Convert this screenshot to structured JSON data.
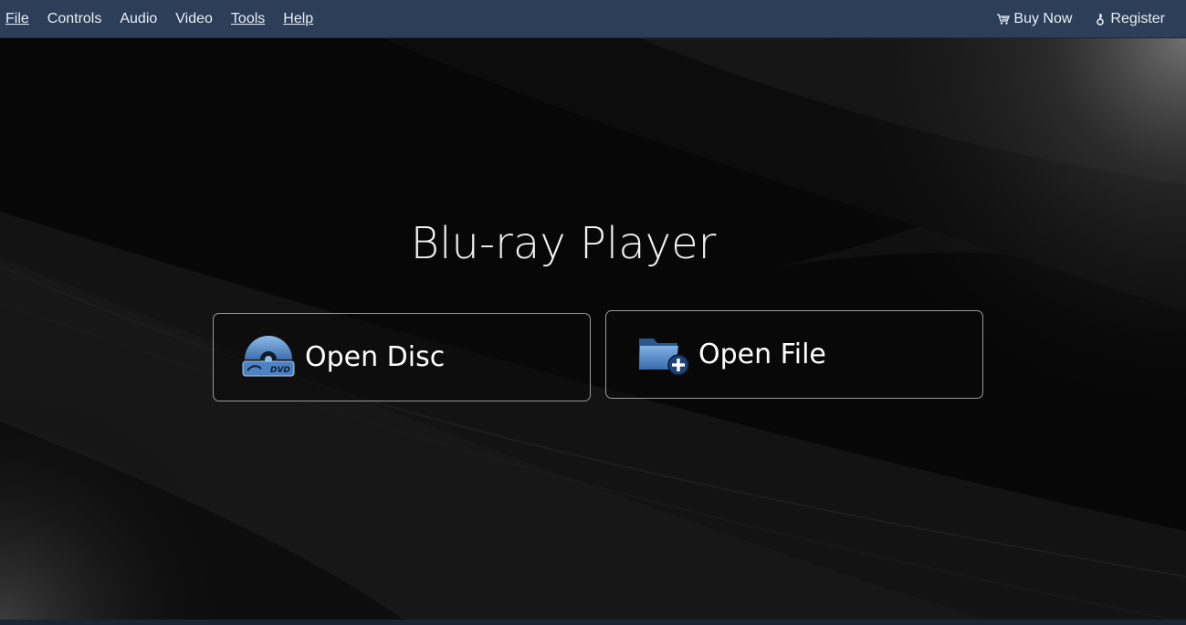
{
  "menubar": {
    "items": [
      {
        "label": "File",
        "mnemonic": true
      },
      {
        "label": "Controls",
        "mnemonic": false
      },
      {
        "label": "Audio",
        "mnemonic": false
      },
      {
        "label": "Video",
        "mnemonic": false
      },
      {
        "label": "Tools",
        "mnemonic": true
      },
      {
        "label": "Help",
        "mnemonic": true
      }
    ],
    "buy_now": {
      "label": "Buy Now",
      "icon": "cart-icon"
    },
    "register": {
      "label": "Register",
      "icon": "key-icon"
    }
  },
  "main": {
    "title": "Blu-ray Player",
    "open_disc": {
      "label": "Open Disc",
      "icon": "disc-icon",
      "icon_text": "DVD"
    },
    "open_file": {
      "label": "Open File",
      "icon": "folder-add-icon"
    }
  },
  "colors": {
    "menubar_bg": "#2c3e58",
    "stage_bg": "#050505",
    "accent_blue": "#5b8fcc"
  }
}
